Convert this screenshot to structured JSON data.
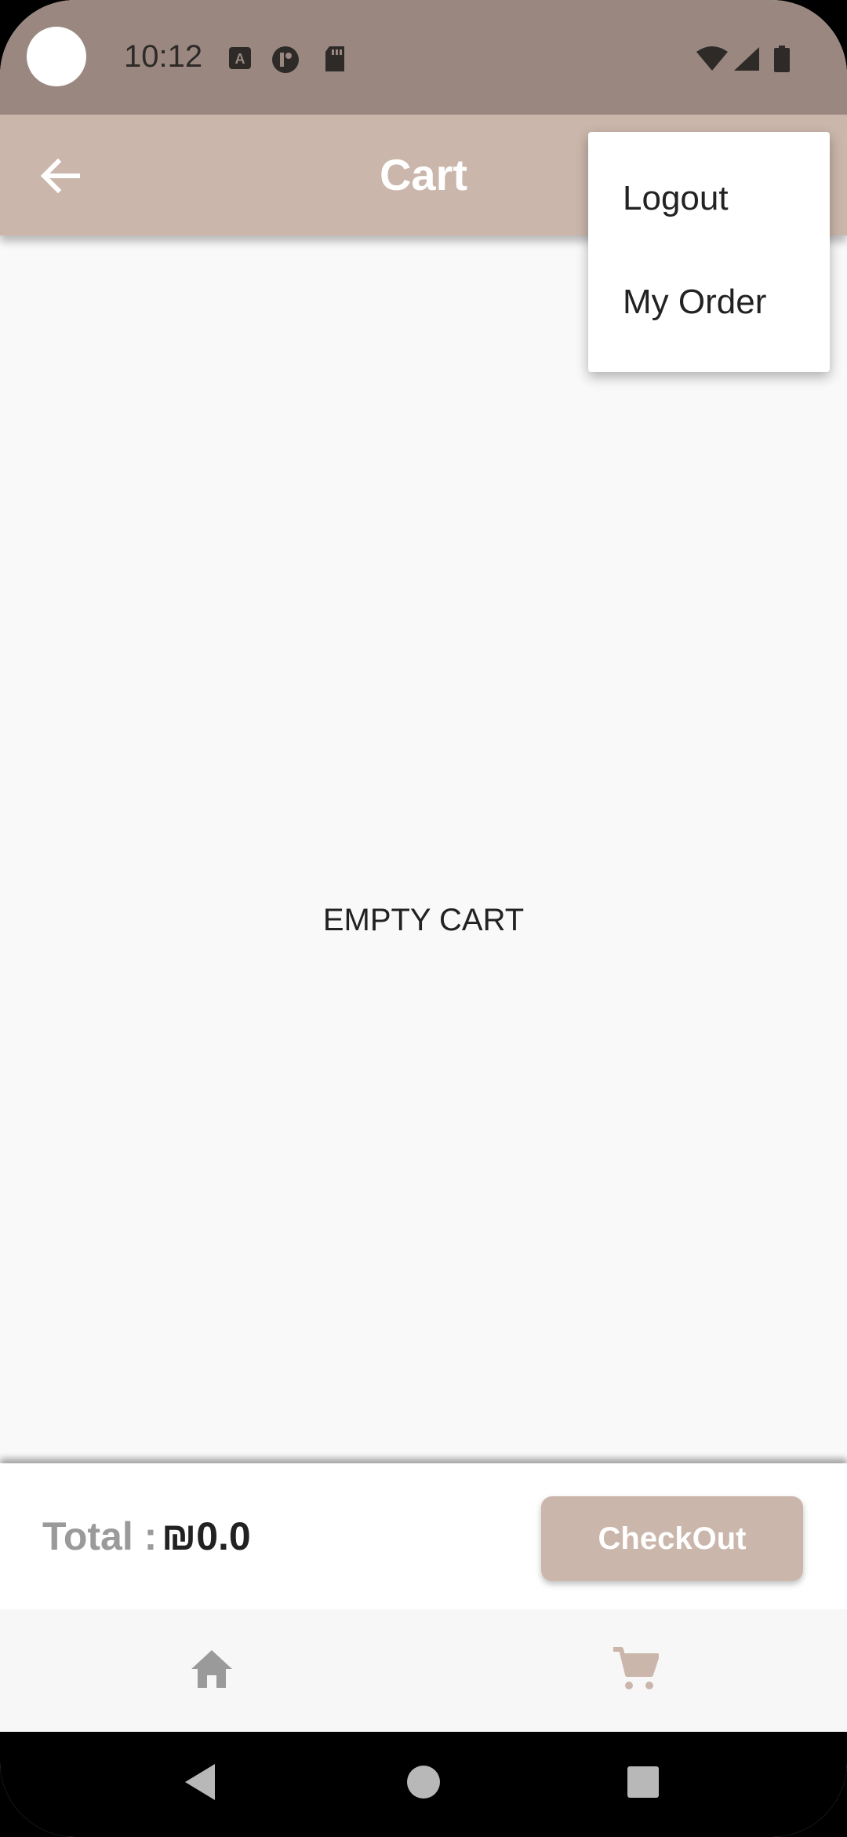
{
  "status_bar": {
    "time": "10:12",
    "icons": [
      "camera-dot",
      "font-a-icon",
      "app-notification-icon",
      "sd-card-icon",
      "wifi-icon",
      "cell-signal-icon",
      "battery-icon"
    ]
  },
  "app_bar": {
    "title": "Cart",
    "back_icon": "arrow-left-icon"
  },
  "menu": {
    "items": [
      {
        "label": "Logout"
      },
      {
        "label": "My Order"
      }
    ]
  },
  "content": {
    "empty_message": "EMPTY CART"
  },
  "total_bar": {
    "label": "Total :",
    "value": "₪0.0",
    "checkout_label": "CheckOut"
  },
  "bottom_nav": {
    "items": [
      {
        "icon": "home-icon",
        "active": false
      },
      {
        "icon": "cart-icon",
        "active": true
      }
    ]
  },
  "colors": {
    "status_bar": "#9a8880",
    "accent": "#cbb6ab",
    "background": "#f9f9f9",
    "inactive_icon": "#9a9a9a"
  }
}
